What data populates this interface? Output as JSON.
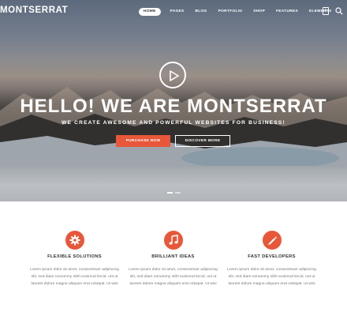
{
  "brand": {
    "logo_text": "MONTSERRAT"
  },
  "nav": {
    "items": [
      {
        "label": "HOME",
        "active": true
      },
      {
        "label": "PAGES",
        "active": false
      },
      {
        "label": "BLOG",
        "active": false
      },
      {
        "label": "PORTFOLIO",
        "active": false
      },
      {
        "label": "SHOP",
        "active": false
      },
      {
        "label": "FEATURES",
        "active": false
      },
      {
        "label": "ELEMENTS",
        "active": false
      }
    ],
    "cart_count": "0",
    "icons": [
      "cart-icon",
      "search-icon"
    ]
  },
  "hero": {
    "title": "HELLO! WE ARE MONTSERRAT",
    "subtitle": "WE CREATE AWESOME AND POWERFUL WEBSITES FOR BUSINESS!",
    "primary_button": "PURCHASE NOW",
    "secondary_button": "DISCOVER MORE",
    "slides": 2,
    "active_slide": 1,
    "play_icon": "play-icon"
  },
  "features": [
    {
      "title": "FLEXIBLE SOLUTIONS",
      "icon": "gear-icon",
      "text": [
        "Lorem ipsum dolor sit amet, consectetuer adipiscing",
        "elit, sed diam nonummy nibh euismod tincid. unt ut",
        "laoreet dolore magna aliquam erat volutpat. Ut wisi"
      ]
    },
    {
      "title": "BRILLIANT IDEAS",
      "icon": "music-note-icon",
      "text": [
        "Lorem ipsum dolor sit amet, consectetuer adipiscing",
        "elit, sed diam nonummy nibh euismod tincid. unt ut",
        "laoreet dolore magna aliquam erat volutpat. Ut wisi"
      ]
    },
    {
      "title": "FAST DEVELOPERS",
      "icon": "pencil-icon",
      "text": [
        "Lorem ipsum dolor sit amet, consectetuer adipiscing",
        "elit, sed diam nonummy nibh euismod tincid. unt ut",
        "laoreet dolore magna aliquam erat volutpat. Ut wisi"
      ]
    }
  ],
  "colors": {
    "accent": "#e8573a",
    "heading": "#333333",
    "body_text": "#777777"
  }
}
